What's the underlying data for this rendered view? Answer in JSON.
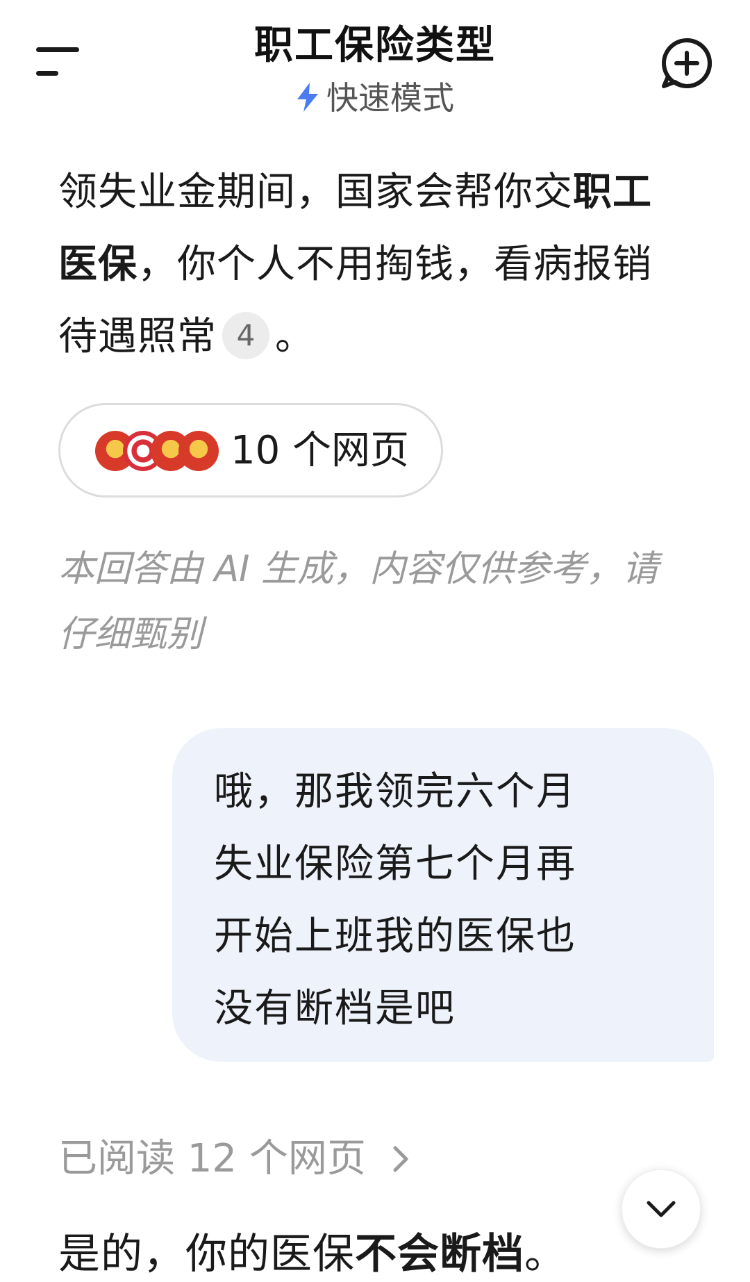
{
  "header": {
    "title": "职工保险类型",
    "mode_label": "快速模式",
    "menu_icon": "menu-icon",
    "new_chat_icon": "new-chat-plus-icon",
    "accent_color": "#4a7cf0"
  },
  "answer": {
    "part1": "领失业金期间，国家会帮你交",
    "bold1": "职工医保",
    "part2": "，你个人不用掏钱，看病报销待遇照常",
    "citation": "4",
    "part3": "。"
  },
  "sources": {
    "label": "10 个网页",
    "favicons": [
      "gov-emblem-icon",
      "red-circle-logo-icon",
      "gov-emblem-icon",
      "gov-emblem-icon"
    ]
  },
  "disclaimer": "本回答由 AI 生成，内容仅供参考，请仔细甄别",
  "user_message": {
    "line1": "哦，那我领完六个月",
    "line2": "失业保险第七个月再",
    "line3": "开始上班我的医保也",
    "line4": "没有断档是吧"
  },
  "read_row": {
    "label": "已阅读 12 个网页"
  },
  "final_answer": {
    "part1": "是的，你的医保",
    "bold1": "不会断档",
    "part2": "。"
  }
}
